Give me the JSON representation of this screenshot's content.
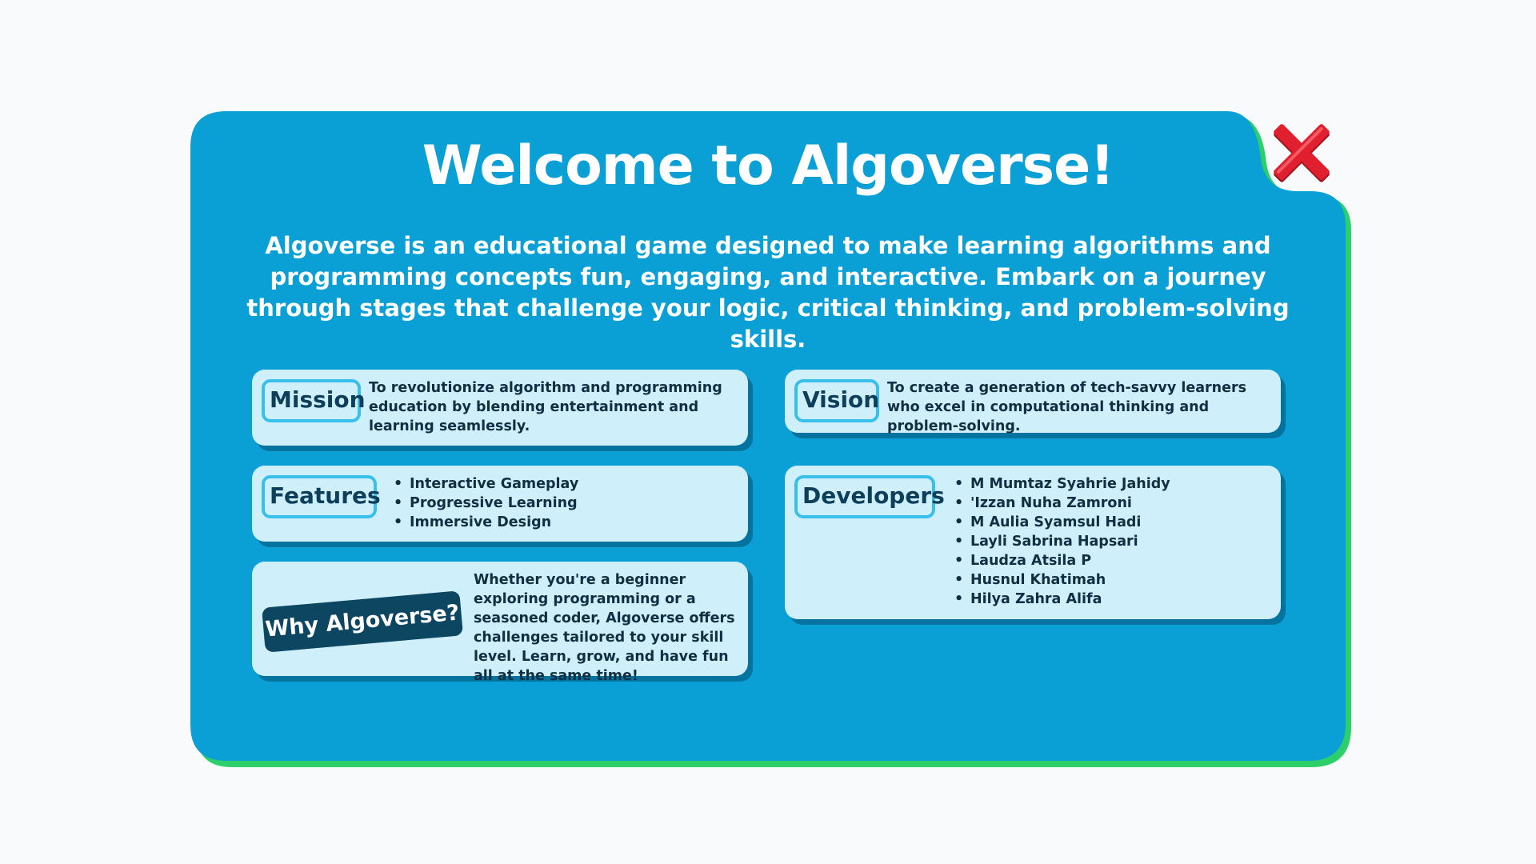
{
  "about": {
    "title": "Welcome to Algoverse!",
    "description": "Algoverse is an educational game designed to make learning algorithms and programming concepts fun, engaging, and interactive. Embark on a journey through stages that challenge your logic, critical thinking, and problem-solving skills."
  },
  "close_button": {
    "icon": "red-x-icon",
    "color": "#e0202e"
  },
  "cards": {
    "mission": {
      "label": "Mission",
      "text": "To revolutionize algorithm and programming education by blending entertainment and learning seamlessly."
    },
    "vision": {
      "label": "Vision",
      "text": "To create a generation of tech-savvy learners who excel in computational thinking and problem-solving."
    },
    "features": {
      "label": "Features",
      "items": [
        "Interactive Gameplay",
        "Progressive Learning",
        "Immersive Design"
      ]
    },
    "developers": {
      "label": "Developers",
      "items": [
        "M Mumtaz Syahrie Jahidy",
        "'Izzan Nuha Zamroni",
        "M Aulia Syamsul Hadi",
        "Layli Sabrina Hapsari",
        "Laudza Atsila P",
        "Husnul Khatimah",
        "Hilya Zahra Alifa"
      ]
    },
    "why": {
      "label": "Why Algoverse?",
      "text": "Whether you're a beginner exploring programming or a seasoned coder, Algoverse offers challenges tailored to your skill level. Learn, grow, and have fun all at the same time!"
    }
  },
  "colors": {
    "page_background": "#f8fafb",
    "panel": "#0aa0d6",
    "panel_outline": "#2ccf6a",
    "card": "#cfeffb",
    "tag_border": "#38c0ea",
    "why_tag": "#0c4660",
    "text_dark": "#0f2f43"
  }
}
